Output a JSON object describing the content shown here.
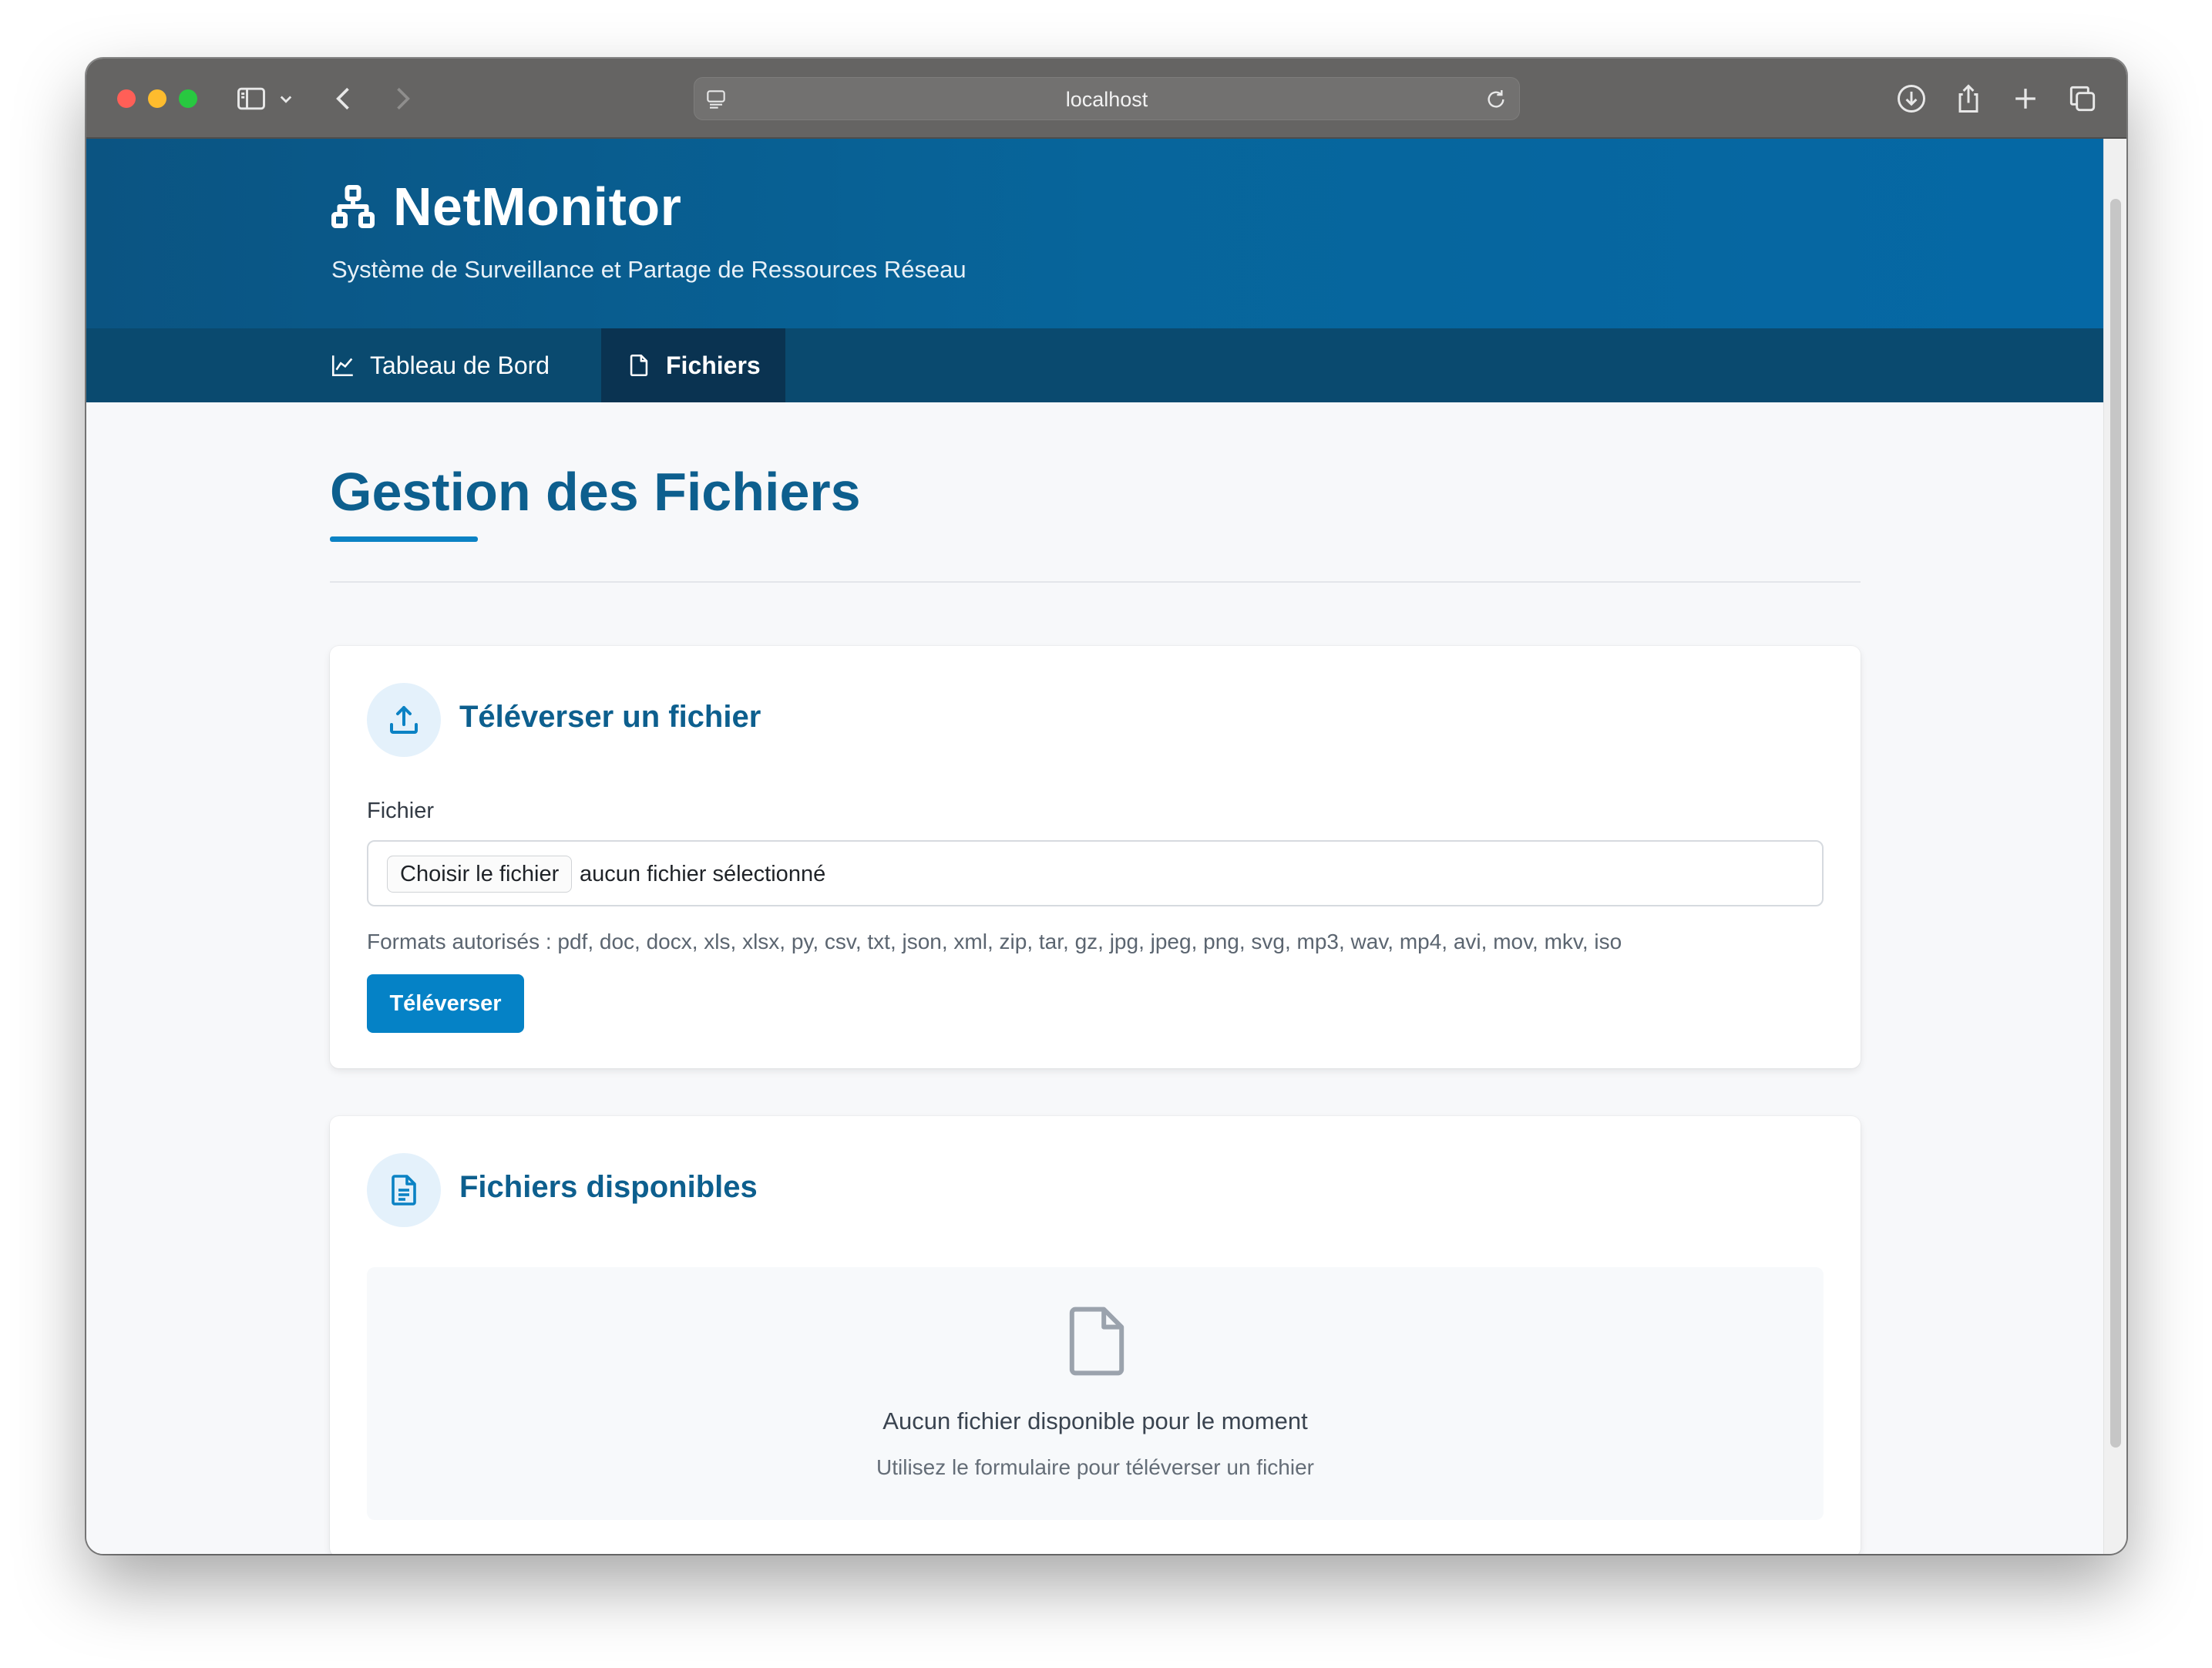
{
  "browser": {
    "url": "localhost"
  },
  "header": {
    "app_name": "NetMonitor",
    "subtitle": "Système de Surveillance et Partage de Ressources Réseau"
  },
  "nav": {
    "items": [
      {
        "label": "Tableau de Bord",
        "icon": "chart-line-icon",
        "active": false
      },
      {
        "label": "Fichiers",
        "icon": "file-icon",
        "active": true
      }
    ]
  },
  "main": {
    "title": "Gestion des Fichiers",
    "upload_card": {
      "title": "Téléverser un fichier",
      "icon": "upload-icon",
      "field_label": "Fichier",
      "choose_button": "Choisir le fichier",
      "file_status": "aucun fichier sélectionné",
      "formats_hint": "Formats autorisés : pdf, doc, docx, xls, xlsx, py, csv, txt, json, xml, zip, tar, gz, jpg, jpeg, png, svg, mp3, wav, mp4, avi, mov, mkv, iso",
      "submit_label": "Téléverser"
    },
    "files_card": {
      "title": "Fichiers disponibles",
      "icon": "file-text-icon",
      "empty_title": "Aucun fichier disponible pour le moment",
      "empty_subtitle": "Utilisez le formulaire pour téléverser un fichier"
    }
  },
  "colors": {
    "header_bg": "#07659b",
    "nav_bg": "#0a4a6f",
    "nav_active_bg": "#0a3351",
    "accent": "#0582c6",
    "title_color": "#0d5f8e"
  }
}
